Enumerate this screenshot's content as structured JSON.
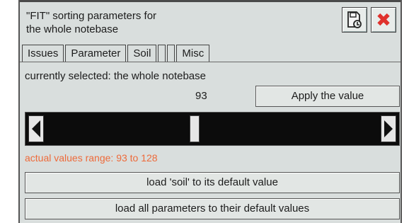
{
  "window": {
    "title": "\"FIT\" sorting parameters for\nthe whole notebase"
  },
  "tabs": [
    {
      "label": "Issues"
    },
    {
      "label": "Parameter"
    },
    {
      "label": "Soil",
      "active": true
    },
    {
      "label": ""
    },
    {
      "label": ""
    },
    {
      "label": "Misc"
    }
  ],
  "main": {
    "selected_label": "currently selected: the whole notebase",
    "value": "93",
    "apply_label": "Apply the value",
    "range_label": "actual values range:  93 to 128",
    "range_min": 93,
    "range_max": 128,
    "slider_value": 93,
    "load_soil_label": "load 'soil' to its default value",
    "load_all_label": "load all parameters to their default values"
  },
  "colors": {
    "accent_orange": "#ee6a3a",
    "close_red": "#e0322d",
    "panel_bg": "#d9dedd",
    "slider_track": "#0c0c0c"
  },
  "icons": {
    "save": "save-icon",
    "close": "close-icon"
  }
}
